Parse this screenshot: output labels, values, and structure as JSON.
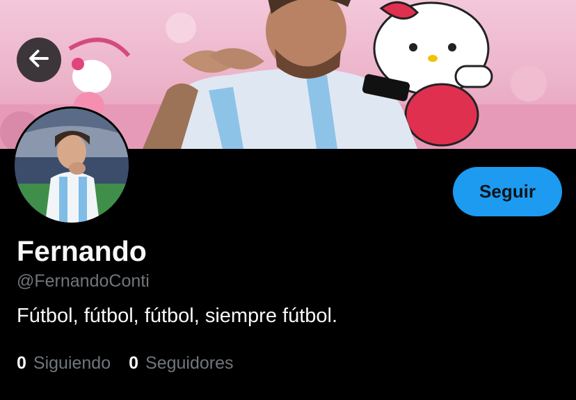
{
  "profile": {
    "name": "Fernando",
    "handle": "@FernandoConti",
    "bio": "Fútbol, fútbol, fútbol, siempre fútbol."
  },
  "actions": {
    "follow_label": "Seguir",
    "back_icon": "arrow-left-icon"
  },
  "stats": {
    "following_count": "0",
    "following_label": "Siguiendo",
    "followers_count": "0",
    "followers_label": "Seguidores"
  },
  "colors": {
    "background": "#000000",
    "accent": "#1d9bf0",
    "muted_text": "#71767b",
    "banner_pink": "#ecb3c9"
  }
}
